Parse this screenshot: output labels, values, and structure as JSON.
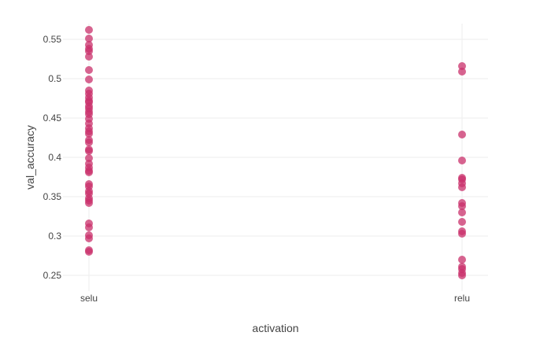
{
  "chart_data": {
    "type": "scatter",
    "title": "",
    "xlabel": "activation",
    "ylabel": "val_accuracy",
    "x_type": "category",
    "categories": [
      "selu",
      "relu"
    ],
    "ylim": [
      0.23,
      0.57
    ],
    "y_ticks": [
      0.25,
      0.3,
      0.35,
      0.4,
      0.45,
      0.5,
      0.55
    ],
    "y_tick_labels": [
      "0.25",
      "0.3",
      "0.35",
      "0.4",
      "0.45",
      "0.5",
      "0.55"
    ],
    "grid": true,
    "legend": "none",
    "marker_color": "#c9306b",
    "marker_opacity": 0.75,
    "gridline_color": "#eeeeee",
    "series": [
      {
        "points": [
          {
            "x": "selu",
            "y": 0.562
          },
          {
            "x": "selu",
            "y": 0.551
          },
          {
            "x": "selu",
            "y": 0.543
          },
          {
            "x": "selu",
            "y": 0.538
          },
          {
            "x": "selu",
            "y": 0.535
          },
          {
            "x": "selu",
            "y": 0.528
          },
          {
            "x": "selu",
            "y": 0.511
          },
          {
            "x": "selu",
            "y": 0.499
          },
          {
            "x": "selu",
            "y": 0.485
          },
          {
            "x": "selu",
            "y": 0.481
          },
          {
            "x": "selu",
            "y": 0.476
          },
          {
            "x": "selu",
            "y": 0.472
          },
          {
            "x": "selu",
            "y": 0.47
          },
          {
            "x": "selu",
            "y": 0.465
          },
          {
            "x": "selu",
            "y": 0.462
          },
          {
            "x": "selu",
            "y": 0.458
          },
          {
            "x": "selu",
            "y": 0.455
          },
          {
            "x": "selu",
            "y": 0.449
          },
          {
            "x": "selu",
            "y": 0.443
          },
          {
            "x": "selu",
            "y": 0.437
          },
          {
            "x": "selu",
            "y": 0.433
          },
          {
            "x": "selu",
            "y": 0.43
          },
          {
            "x": "selu",
            "y": 0.422
          },
          {
            "x": "selu",
            "y": 0.419
          },
          {
            "x": "selu",
            "y": 0.41
          },
          {
            "x": "selu",
            "y": 0.408
          },
          {
            "x": "selu",
            "y": 0.399
          },
          {
            "x": "selu",
            "y": 0.392
          },
          {
            "x": "selu",
            "y": 0.387
          },
          {
            "x": "selu",
            "y": 0.383
          },
          {
            "x": "selu",
            "y": 0.381
          },
          {
            "x": "selu",
            "y": 0.366
          },
          {
            "x": "selu",
            "y": 0.363
          },
          {
            "x": "selu",
            "y": 0.357
          },
          {
            "x": "selu",
            "y": 0.354
          },
          {
            "x": "selu",
            "y": 0.348
          },
          {
            "x": "selu",
            "y": 0.345
          },
          {
            "x": "selu",
            "y": 0.342
          },
          {
            "x": "selu",
            "y": 0.316
          },
          {
            "x": "selu",
            "y": 0.311
          },
          {
            "x": "selu",
            "y": 0.301
          },
          {
            "x": "selu",
            "y": 0.297
          },
          {
            "x": "selu",
            "y": 0.282
          },
          {
            "x": "selu",
            "y": 0.28
          },
          {
            "x": "relu",
            "y": 0.516
          },
          {
            "x": "relu",
            "y": 0.509
          },
          {
            "x": "relu",
            "y": 0.429
          },
          {
            "x": "relu",
            "y": 0.396
          },
          {
            "x": "relu",
            "y": 0.374
          },
          {
            "x": "relu",
            "y": 0.372
          },
          {
            "x": "relu",
            "y": 0.367
          },
          {
            "x": "relu",
            "y": 0.362
          },
          {
            "x": "relu",
            "y": 0.342
          },
          {
            "x": "relu",
            "y": 0.338
          },
          {
            "x": "relu",
            "y": 0.33
          },
          {
            "x": "relu",
            "y": 0.318
          },
          {
            "x": "relu",
            "y": 0.306
          },
          {
            "x": "relu",
            "y": 0.303
          },
          {
            "x": "relu",
            "y": 0.27
          },
          {
            "x": "relu",
            "y": 0.261
          },
          {
            "x": "relu",
            "y": 0.258
          },
          {
            "x": "relu",
            "y": 0.253
          },
          {
            "x": "relu",
            "y": 0.25
          }
        ]
      }
    ]
  }
}
